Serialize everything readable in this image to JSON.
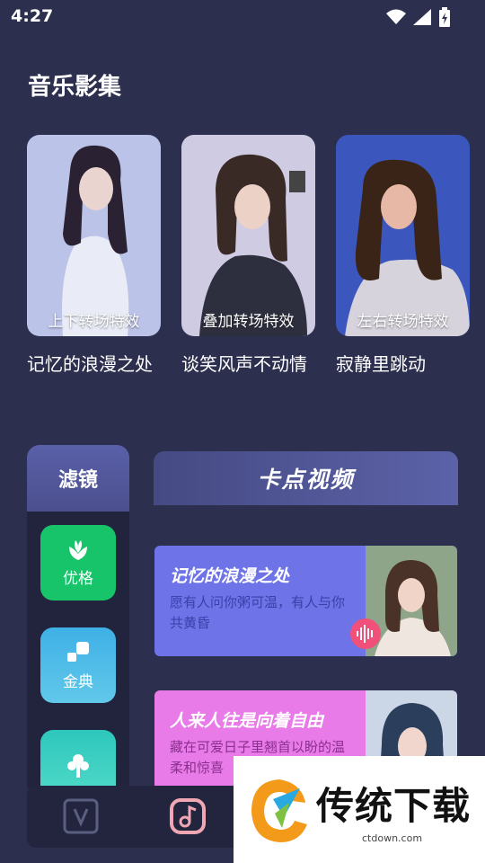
{
  "status_bar": {
    "time": "4:27"
  },
  "section_title": "音乐影集",
  "albums": [
    {
      "caption": "上下转场特效",
      "title": "记忆的浪漫之处",
      "bg": "#bfc5e6"
    },
    {
      "caption": "叠加转场特效",
      "title": "谈笑风声不动情",
      "bg": "#c9c6e0"
    },
    {
      "caption": "左右转场特效",
      "title": "寂静里跳动",
      "bg": "#3e57b8"
    }
  ],
  "filter": {
    "title": "滤镜",
    "items": [
      {
        "label": "优格",
        "color": "#17c46a",
        "icon": "flower-icon"
      },
      {
        "label": "金典",
        "color": "#4fb8e8",
        "icon": "squares-icon"
      },
      {
        "label": "",
        "color": "#3ed0c4",
        "icon": "tree-icon"
      }
    ]
  },
  "beat": {
    "title": "卡点视频",
    "cards": [
      {
        "title": "记忆的浪漫之处",
        "desc": "愿有人问你粥可温，有人与你共黄昏",
        "color": "#6e73e8",
        "desc_color": "#3b3fa8"
      },
      {
        "title": "人来人往是向着自由",
        "desc": "藏在可爱日子里翘首以盼的温柔和惊喜",
        "color": "#e97be9",
        "desc_color": "#8a2f8f"
      }
    ]
  },
  "watermark": {
    "brand": "传统下载",
    "url": "ctdown.com"
  }
}
